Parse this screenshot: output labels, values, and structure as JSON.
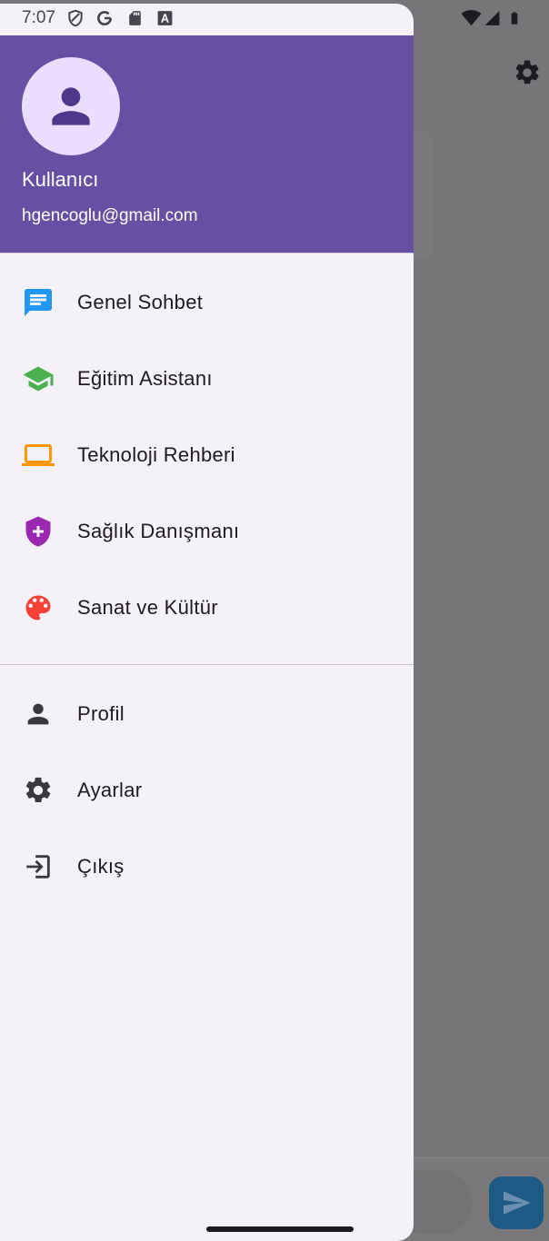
{
  "status_bar": {
    "time": "7:07"
  },
  "header": {
    "user_name": "Kullanıcı",
    "user_email": "hgencoglu@gmail.com"
  },
  "menu": {
    "primary": [
      {
        "label": "Genel Sohbet",
        "icon": "chat-icon",
        "color": "#2196f3"
      },
      {
        "label": "Eğitim Asistanı",
        "icon": "school-icon",
        "color": "#4caf50"
      },
      {
        "label": "Teknoloji Rehberi",
        "icon": "laptop-icon",
        "color": "#ff9800"
      },
      {
        "label": "Sağlık Danışmanı",
        "icon": "health-shield-icon",
        "color": "#9c27b0"
      },
      {
        "label": "Sanat ve Kültür",
        "icon": "palette-icon",
        "color": "#f44336"
      }
    ],
    "secondary": [
      {
        "label": "Profil",
        "icon": "person-icon"
      },
      {
        "label": "Ayarlar",
        "icon": "settings-icon"
      },
      {
        "label": "Çıkış",
        "icon": "logout-icon"
      }
    ]
  },
  "colors": {
    "header_bg": "#6750a4",
    "drawer_bg": "#f5f1f8",
    "scrim": "#777577"
  }
}
